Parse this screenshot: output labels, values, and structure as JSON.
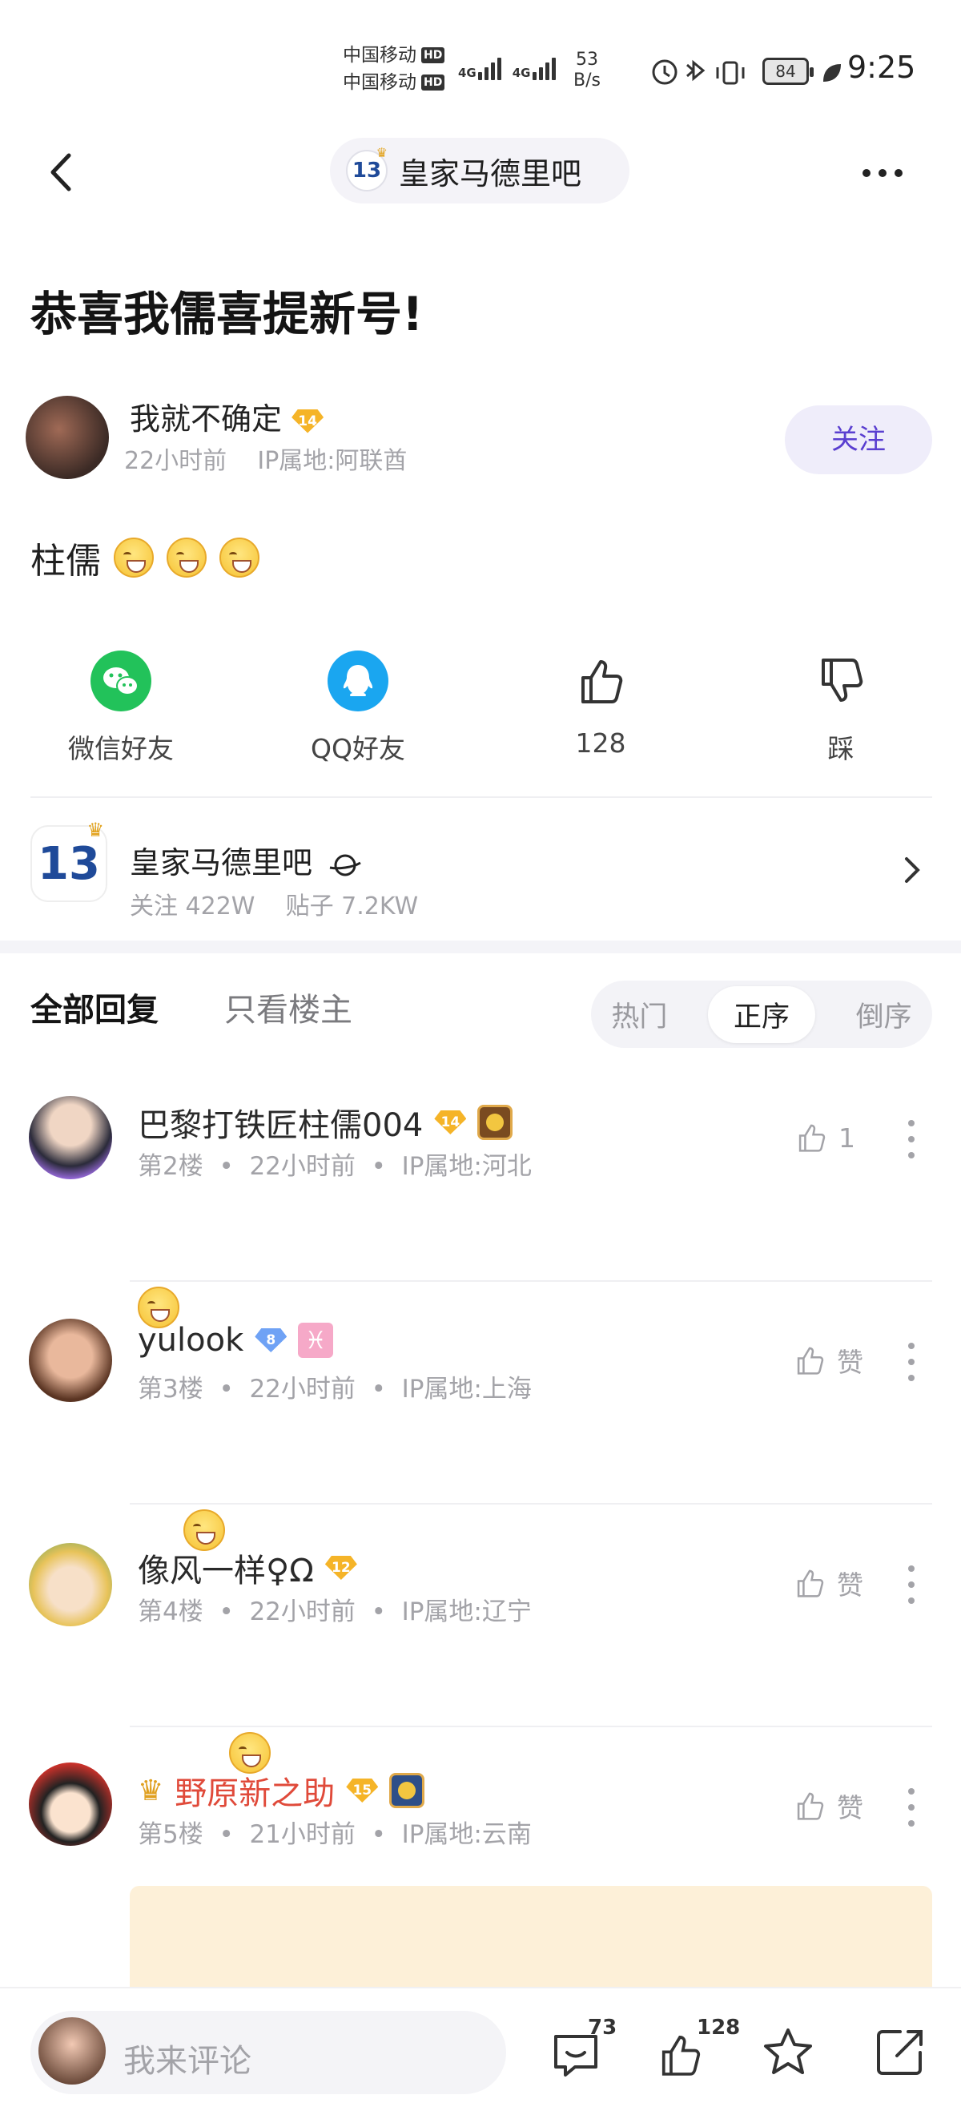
{
  "status_bar": {
    "carrier1": "中国移动",
    "carrier2": "中国移动",
    "hd": "HD",
    "net": "4G",
    "speed_value": "53",
    "speed_unit": "B/s",
    "battery": "84",
    "time": "9:25"
  },
  "header": {
    "forum_badge": "13",
    "forum_name": "皇家马德里吧"
  },
  "post": {
    "title": "恭喜我儒喜提新号!",
    "author": "我就不确定",
    "author_level": "14",
    "author_time": "22小时前",
    "author_ip": "IP属地:阿联酋",
    "follow_label": "关注",
    "content_text": "柱儒"
  },
  "actions": {
    "wechat": "微信好友",
    "qq": "QQ好友",
    "like_count": "128",
    "dislike": "踩"
  },
  "forum_card": {
    "badge": "13",
    "name": "皇家马德里吧",
    "followers": "关注 422W",
    "posts": "贴子 7.2KW"
  },
  "tabs": {
    "all": "全部回复",
    "op_only": "只看楼主",
    "sort": [
      "热门",
      "正序",
      "倒序"
    ],
    "sort_selected": "正序"
  },
  "comments": [
    {
      "name": "巴黎打铁匠柱儒004",
      "level": "14",
      "floor": "第2楼",
      "time": "22小时前",
      "ip": "IP属地:河北",
      "like": "1"
    },
    {
      "name": "yulook",
      "level": "8",
      "floor": "第3楼",
      "time": "22小时前",
      "ip": "IP属地:上海",
      "like": "赞"
    },
    {
      "name": "像风一样♀Ω",
      "level": "12",
      "floor": "第4楼",
      "time": "22小时前",
      "ip": "IP属地:辽宁",
      "like": "赞"
    },
    {
      "name": "野原新之助",
      "level": "15",
      "floor": "第5楼",
      "time": "21小时前",
      "ip": "IP属地:云南",
      "like": "赞"
    }
  ],
  "bottom_bar": {
    "placeholder": "我来评论",
    "comment_count": "73",
    "like_count": "128"
  },
  "colors": {
    "accent": "#5a3fd0",
    "wechat": "#22c25a",
    "qq": "#1aa6f0",
    "level_gold": "#f5b428",
    "red_name": "#e04a3a"
  }
}
